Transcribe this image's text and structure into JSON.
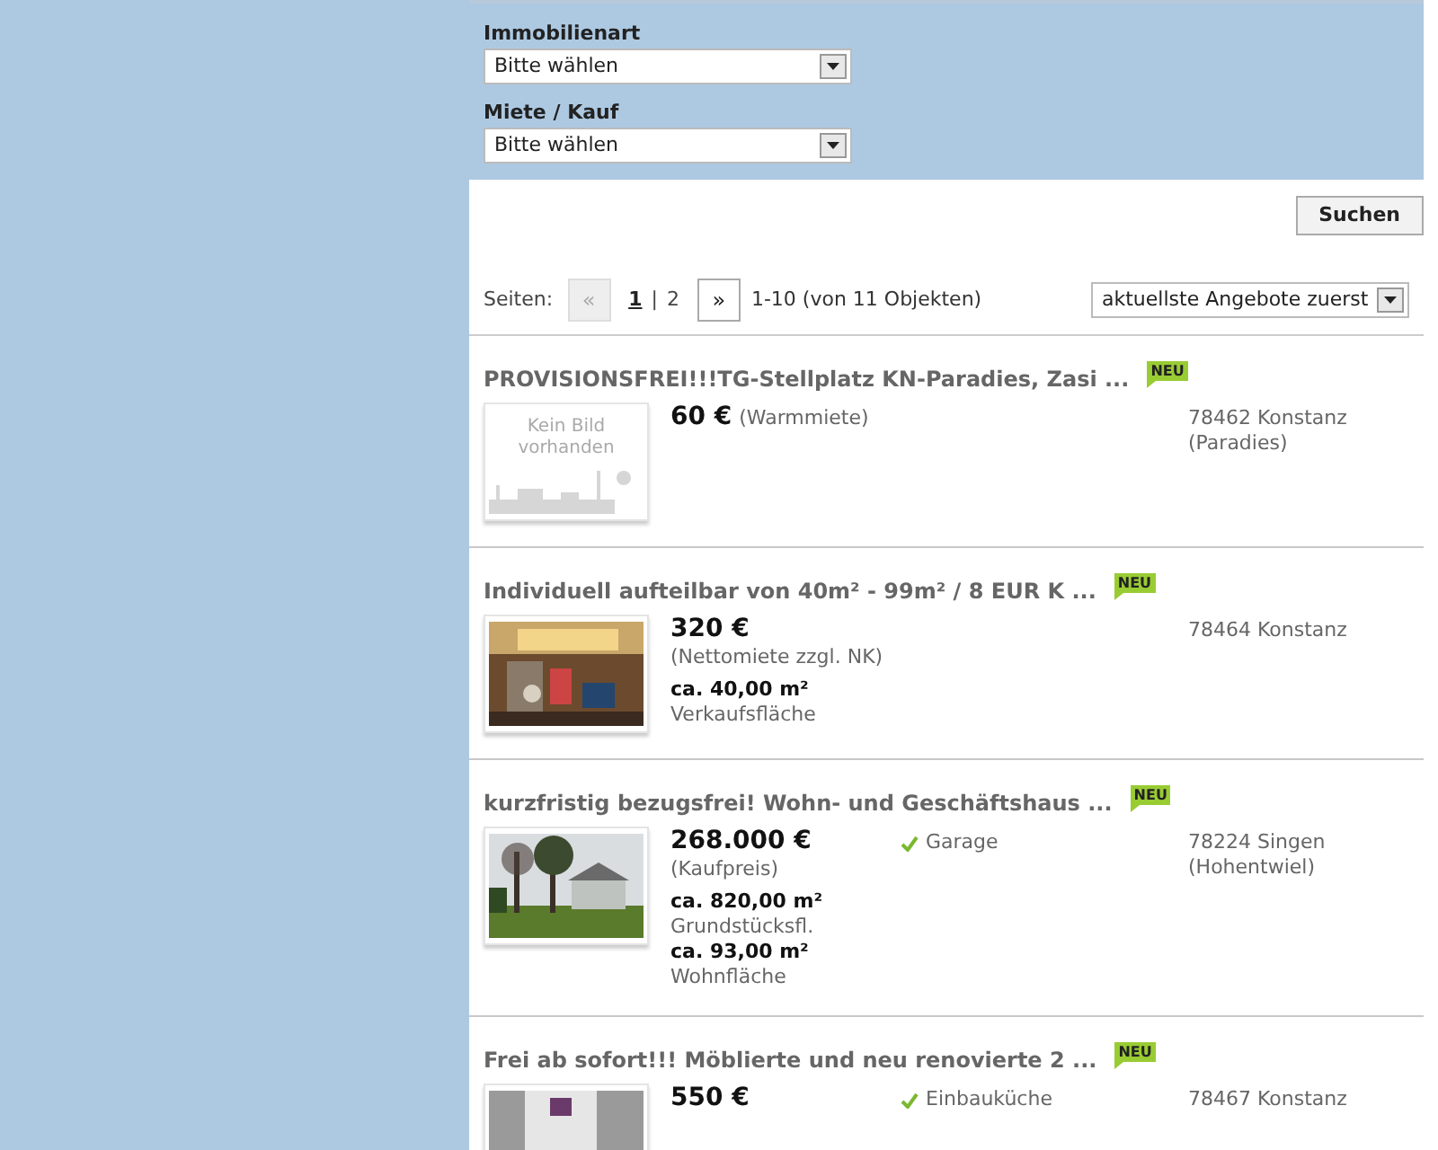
{
  "search_form": {
    "fields": [
      {
        "label": "Immobilienart",
        "value": "Bitte wählen"
      },
      {
        "label": "Miete / Kauf",
        "value": "Bitte wählen"
      }
    ],
    "button": "Suchen"
  },
  "pagination": {
    "label": "Seiten:",
    "prev": {
      "label": "«",
      "disabled": true
    },
    "pages": [
      {
        "label": "1",
        "selected": true
      },
      {
        "label": "2",
        "selected": false
      }
    ],
    "separator": "|",
    "next": {
      "label": "»",
      "disabled": false
    },
    "summary": "1-10 (von 11 Objekten)",
    "sort": "aktuellste Angebote zuerst"
  },
  "listings": [
    {
      "title": "PROVISIONSFREI!!!TG-Stellplatz KN-Paradies, Zasi ...",
      "badge": "NEU",
      "image": {
        "kind": "placeholder",
        "text": [
          "Kein Bild",
          "vorhanden"
        ]
      },
      "price": "60 €",
      "price_note": "(Warmmiete)",
      "location": [
        "78462 Konstanz",
        "(Paradies)"
      ]
    },
    {
      "title": "Individuell aufteilbar von 40m² - 99m² / 8 EUR K ...",
      "badge": "NEU",
      "image": {
        "kind": "picture"
      },
      "price": "320 €",
      "price_note": "(Nettomiete zzgl. NK)",
      "areas": [
        {
          "value": "ca. 40,00 m²",
          "label": "Verkaufsfläche"
        }
      ],
      "location": [
        "78464 Konstanz"
      ]
    },
    {
      "title": "kurzfristig bezugsfrei! Wohn- und Geschäftshaus ...",
      "badge": "NEU",
      "image": {
        "kind": "picture"
      },
      "price": "268.000 €",
      "price_note": "(Kaufpreis)",
      "areas": [
        {
          "value": "ca. 820,00 m²",
          "label": "Grundstücksfl."
        },
        {
          "value": "ca. 93,00 m²",
          "label": "Wohnfläche"
        }
      ],
      "feature": "Garage",
      "location": [
        "78224 Singen",
        "(Hohentwiel)"
      ]
    },
    {
      "title": "Frei ab sofort!!! Möblierte und neu renovierte 2 ...",
      "badge": "NEU",
      "image": {
        "kind": "picture"
      },
      "price": "550 €",
      "feature": "Einbauküche",
      "location": [
        "78467 Konstanz"
      ]
    }
  ]
}
